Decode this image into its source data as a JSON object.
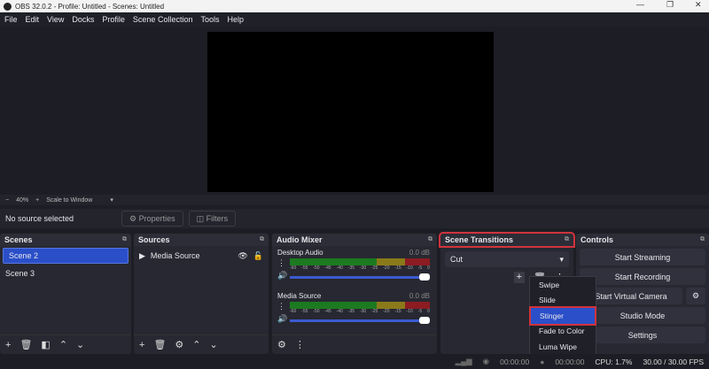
{
  "window": {
    "title": "OBS 32.0.2 - Profile: Untitled - Scenes: Untitled",
    "minimize": "—",
    "maximize": "❐",
    "close": "✕"
  },
  "menu": [
    "File",
    "Edit",
    "View",
    "Docks",
    "Profile",
    "Scene Collection",
    "Tools",
    "Help"
  ],
  "zoom": {
    "minus": "−",
    "level": "40%",
    "plus": "+",
    "mode": "Scale to Window",
    "arrow": "▾"
  },
  "source_bar": {
    "status": "No source selected",
    "properties": "Properties",
    "filters": "Filters"
  },
  "scenes": {
    "title": "Scenes",
    "items": [
      "Scene 2",
      "Scene 3"
    ],
    "selected": 0
  },
  "sources": {
    "title": "Sources",
    "items": [
      "Media Source"
    ]
  },
  "mixer": {
    "title": "Audio Mixer",
    "channels": [
      {
        "name": "Desktop Audio",
        "level": "0.0 dB"
      },
      {
        "name": "Media Source",
        "level": "0.0 dB"
      }
    ],
    "ticks": [
      "-60",
      "-55",
      "-50",
      "-45",
      "-40",
      "-35",
      "-30",
      "-25",
      "-20",
      "-15",
      "-10",
      "-5",
      "0"
    ]
  },
  "transitions": {
    "title": "Scene Transitions",
    "current": "Cut",
    "menu": [
      "Swipe",
      "Slide",
      "Stinger",
      "Fade to Color",
      "Luma Wipe"
    ],
    "highlighted": 2
  },
  "controls": {
    "title": "Controls",
    "start_streaming": "Start Streaming",
    "start_recording": "Start Recording",
    "start_virtual_camera": "Start Virtual Camera",
    "studio_mode": "Studio Mode",
    "settings": "Settings"
  },
  "status": {
    "stream_time": "00:00:00",
    "rec_time": "00:00:00",
    "cpu": "CPU: 1.7%",
    "fps": "30.00 / 30.00 FPS"
  }
}
